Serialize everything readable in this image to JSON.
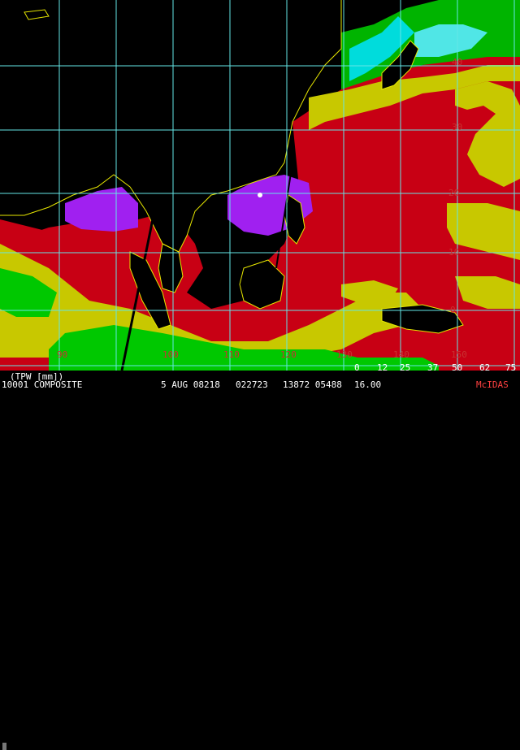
{
  "map": {
    "product_label": "(TPW [mm])",
    "composite_line": "10001 COMPOSITE",
    "date": "5 AUG 08218",
    "time_code": "022723",
    "numbers": "13872 05488",
    "extra": "16.00",
    "credit": "McIDAS",
    "latitudes": [
      "40",
      "30",
      "20",
      "10",
      "0"
    ],
    "longitudes": [
      "90",
      "100",
      "110",
      "120",
      "130",
      "140",
      "150"
    ],
    "colorbar_ticks": [
      "0",
      "12",
      "25",
      "37",
      "50",
      "62",
      "75"
    ],
    "colorbar_colors": [
      "#0000c8",
      "#00a0ff",
      "#00e0e0",
      "#00c800",
      "#c8c800",
      "#c80000",
      "#ff00ff",
      "#c000c0"
    ],
    "colors": {
      "ocean_moist": "#c80014",
      "mid": "#d2d200",
      "dry": "#00c800",
      "very_dry": "#00e6e6",
      "wet": "#a020f0",
      "land": "#000000",
      "grid": "#64e6e6",
      "coast": "#e6e600"
    }
  }
}
